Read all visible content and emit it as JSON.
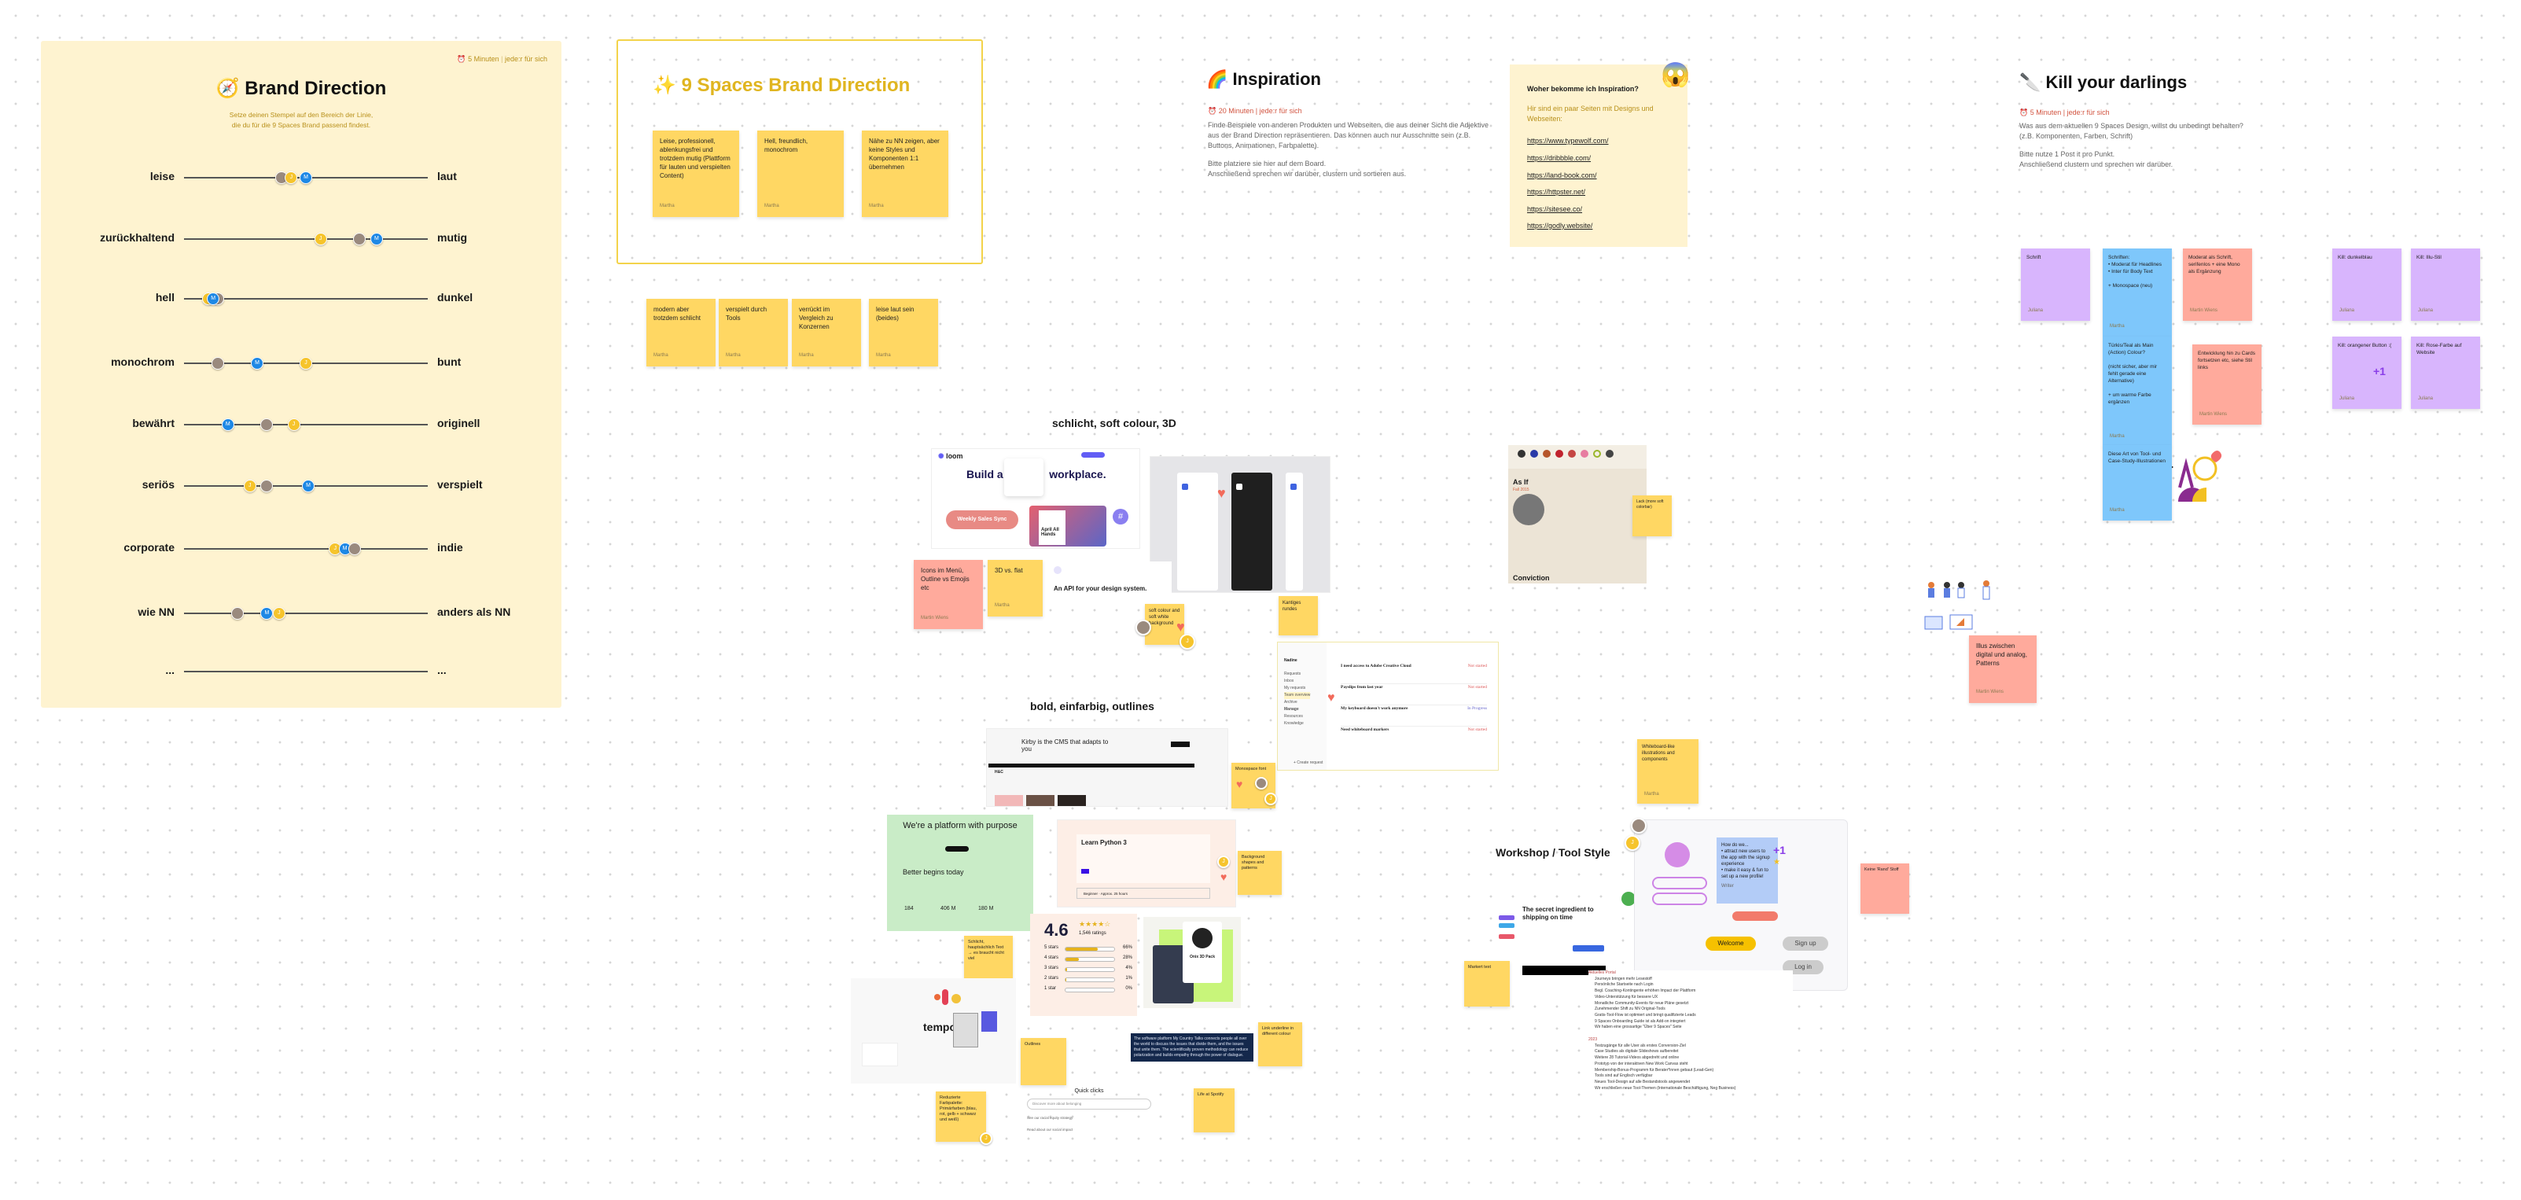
{
  "brand_direction": {
    "timer_icon": "alarm-clock-icon",
    "timer": "5 Minuten",
    "mode": "jede:r für sich",
    "title_icon": "compass-icon",
    "title": "Brand Direction",
    "subtitle_1": "Setze deinen Stempel auf den Bereich der Linie,",
    "subtitle_2": "die du für die 9 Spaces Brand passend findest.",
    "scales": [
      {
        "left": "leise",
        "right": "laut",
        "votes": {
          "photo": 0.4,
          "J": 0.44,
          "M": 0.5
        }
      },
      {
        "left": "zurückhaltend",
        "right": "mutig",
        "votes": {
          "J": 0.56,
          "photo": 0.72,
          "M": 0.79
        }
      },
      {
        "left": "hell",
        "right": "dunkel",
        "votes": {
          "J": 0.1,
          "photo": 0.14,
          "M": 0.12
        }
      },
      {
        "left": "monochrom",
        "right": "bunt",
        "votes": {
          "photo": 0.14,
          "M": 0.3,
          "J": 0.5
        }
      },
      {
        "left": "bewährt",
        "right": "originell",
        "votes": {
          "M": 0.18,
          "photo": 0.34,
          "J": 0.45
        }
      },
      {
        "left": "seriös",
        "right": "verspielt",
        "votes": {
          "J": 0.27,
          "photo": 0.34,
          "M": 0.51
        }
      },
      {
        "left": "corporate",
        "right": "indie",
        "votes": {
          "J": 0.62,
          "M": 0.66,
          "photo": 0.7
        }
      },
      {
        "left": "wie NN",
        "right": "anders als NN",
        "votes": {
          "photo": 0.22,
          "M": 0.34,
          "J": 0.39
        }
      },
      {
        "left": "...",
        "right": "...",
        "votes": {}
      }
    ]
  },
  "nine_spaces": {
    "title_icon": "sparkles-icon",
    "title": "9 Spaces Brand Direction",
    "notes": [
      {
        "text": "Leise, professionell, ablenkungsfrei und trotzdem mutig (Plattform für lauten und verspielten Content)",
        "author": "Martha"
      },
      {
        "text": "Hell, freundlich, monochrom",
        "author": "Martha"
      },
      {
        "text": "Nähe zu NN zeigen, aber keine Styles und Komponenten 1:1 übernehmen",
        "author": "Martha"
      }
    ],
    "extra_notes": [
      {
        "text": "modern aber trotzdem schlicht",
        "author": "Martha"
      },
      {
        "text": "verspielt durch Tools",
        "author": "Martha"
      },
      {
        "text": "verrückt im Vergleich zu Konzernen",
        "author": "Martha"
      },
      {
        "text": "leise laut sein (beides)",
        "author": "Martha"
      }
    ]
  },
  "inspiration": {
    "title_icon": "rainbow-icon",
    "title": "Inspiration",
    "timer": "20 Minuten",
    "mode": "jede:r für sich",
    "body_1": "Finde Beispiele von anderen Produkten und Webseiten, die aus deiner Sicht die Adjektive aus der Brand Direction repräsentieren. Das können auch nur Ausschnitte sein (z.B. Buttons, Animationen, Farbpalette).",
    "body_2": "Bitte platziere sie hier auf dem Board.",
    "body_3": "Anschließend sprechen wir darüber, clustern und sortieren aus.",
    "box_emoji": "screaming-face-icon",
    "box_question": "Woher bekomme ich Inspiration?",
    "box_text": "Hir sind ein paar Seiten mit Designs und Webseiten:",
    "links": [
      "https://www.typewolf.com/",
      "https://dribbble.com/",
      "https://land-book.com/",
      "https://httpster.net/",
      "https://sitesee.co/",
      "https://godly.website/"
    ]
  },
  "kill": {
    "title_icon": "knife-icon",
    "title": "Kill your darlings",
    "timer": "5 Minuten",
    "mode": "jede:r für sich",
    "body_1": "Was aus dem aktuellen 9 Spaces Design, willst du unbedingt behalten?",
    "body_2": "(z.B. Komponenten, Farben, Schrift)",
    "body_3": "Bitte nutze 1 Post it pro Punkt.",
    "body_4": "Anschließend clustern und sprechen wir darüber.",
    "notes": [
      {
        "text": "Schrift",
        "author": "Juliana",
        "color": "purple"
      },
      {
        "text": "Schriften:\n• Moderat für Headlines\n• Inter für Body Text\n\n+ Monospace (neu)",
        "author": "Martha",
        "color": "blue"
      },
      {
        "text": "Moderat als Schrift, serifenlos + eine Mono als Ergänzung",
        "author": "Martin Wiens",
        "color": "pink"
      },
      {
        "text": "Kill: dunkelblau",
        "author": "Juliana",
        "color": "purple"
      },
      {
        "text": "Kill: Illu-Stil",
        "author": "Juliana",
        "color": "purple"
      },
      {
        "text": "Türkis/Teal als Main (Action) Colour?\n\n(nicht sicher, aber mir fehlt gerade eine Alternative)\n\n+ um warme Farbe ergänzen",
        "author": "Martha",
        "color": "blue"
      },
      {
        "text": "Entwicklung hin zu Cards fortsetzen etc, siehe Stil links",
        "author": "Martin Wiens",
        "color": "pink"
      },
      {
        "text": "Kill: orangener Button :(",
        "author": "Juliana",
        "color": "purple",
        "badge": "+1"
      },
      {
        "text": "Kill: Rose-Farbe auf Website",
        "author": "Juliana",
        "color": "purple"
      },
      {
        "text": "Diese Art von Tool- und Case-Study-Illustrationen",
        "author": "Martha",
        "color": "blue"
      }
    ]
  },
  "clusters": {
    "soft": "schlicht, soft colour, 3D",
    "bold": "bold, einfarbig, outlines",
    "workshop": "Workshop / Tool Style"
  },
  "loom_shot": {
    "logo": "loom",
    "headline_a": "Build a t",
    "headline_b": "workplace.",
    "pill": "Weekly Sales Sync",
    "card": "April All Hands",
    "api_title": "An API for your design system."
  },
  "kirby_shot": {
    "headline": "Kirby is the CMS that adapts to you",
    "section": "H&C"
  },
  "platform_shot": {
    "headline": "We're a platform with purpose",
    "sub": "Better begins today",
    "stats": [
      "184",
      "406 M",
      "180 M"
    ]
  },
  "python_shot": {
    "title": "Learn Python 3",
    "level": "Beginner",
    "time": "Approx. 25 hours"
  },
  "rating_shot": {
    "score": "4.6",
    "count": "1,546 ratings",
    "rows": [
      {
        "label": "5 stars",
        "pct": 66
      },
      {
        "label": "4 stars",
        "pct": 28
      },
      {
        "label": "3 stars",
        "pct": 4
      },
      {
        "label": "2 stars",
        "pct": 1
      },
      {
        "label": "1 star",
        "pct": 0
      }
    ]
  },
  "product_shot": {
    "title": "Onix 3D Pack"
  },
  "country_talks": {
    "text": "The software platform My Country Talks connects people all over the world to discuss the issues that divide them, and the issues that unite them. The scientifically proven methodology can reduce polarization and builds empathy through the power of dialogue."
  },
  "quick_clicks": {
    "title": "Quick clicks",
    "search": "Discover more about belonging",
    "items": [
      "See our racial equity strategy",
      "Read about our social impact"
    ]
  },
  "tempo_shot": {
    "word": "tempo"
  },
  "helpdesk_shot": {
    "user": "Nadine",
    "nav": [
      "Requests",
      "Inbox",
      "My requests",
      "Team overview",
      "Archive",
      "Manage",
      "Resources",
      "Knowledge"
    ],
    "items": [
      {
        "title": "I need access to Adobe Creative Cloud",
        "status": "Not started"
      },
      {
        "title": "Payslips from last year",
        "status": "Not started"
      },
      {
        "title": "My keyboard doesn't work anymore",
        "status": "In Progress"
      },
      {
        "title": "Need whiteboard markers",
        "status": "Not started"
      }
    ],
    "footer": "+ Create request"
  },
  "as_if_shot": {
    "title": "As If",
    "season": "Fall 2015",
    "next": "Conviction"
  },
  "workshop_shot": {
    "headline": "The secret ingredient to shipping on time",
    "question": "How do we...",
    "bullets": [
      "attract new users to the app with the signup experience",
      "make it easy & fun to set up a new profile!"
    ],
    "writer": "Writer",
    "welcome": "Welcome",
    "signup": "Sign up",
    "login": "Log in"
  },
  "roadmap": {
    "group_1": "Aktuelles Portal",
    "rows_1": [
      "Journeys bringen mehr Lesestoff",
      "Persönliche Startseite nach Login",
      "Begl. Coaching-Kontingente erhöhen Impact der Plattform",
      "Video-Unterstützung für bessere UX",
      "Monatliche Community-Events für neue Pläne gesetzt",
      "Zunehmender Shift zu NN Original-Tools",
      "Gratis-Tool-Flow ist optimiert und bringt qualifizierte Leads",
      "9 Spaces Onboarding Guide ist als Add-on integriert",
      "Wir haben eine grossartige \"Über 9 Spaces\" Seite"
    ],
    "group_2": "2023",
    "rows_2": [
      "Testzugänge für alle User als erstes Conversion-Ziel",
      "Case Studies als digitale Slideshows aufbereitet",
      "Weitere 28 Tutorial-Videos abgedreht und online",
      "Prototyp von der interaktiven New Work Canvas steht",
      "Membership-Bonus-Programm für Berater*innen gebaut (Lead-Gen)",
      "Tools sind auf Englisch verfügbar",
      "Neues Tool-Design auf alle Bestandstools angewendet",
      "Wir erschließen neue Tool-Themen (Internationale Beschäftigung, Neg Business)"
    ]
  },
  "scattered_notes": [
    {
      "id": "icons",
      "text": "Icons im Menü, Outline vs Emojis etc",
      "author": "Martin Wiens",
      "color": "pink"
    },
    {
      "id": "3d",
      "text": "3D vs. flat",
      "author": "Martha",
      "color": "yellow"
    },
    {
      "id": "softwhite",
      "text": "soft colour and soft white background",
      "author": "Martha",
      "color": "yellow"
    },
    {
      "id": "kantig",
      "text": "Kantiges rundes",
      "author": "Juliana",
      "color": "yellow"
    },
    {
      "id": "mono",
      "text": "Monospace font",
      "author": "Martha",
      "color": "yellow"
    },
    {
      "id": "bgshapes",
      "text": "Background shapes and patterns",
      "author": "Martha",
      "color": "yellow"
    },
    {
      "id": "schlicht",
      "text": "Schlicht, hauptsächlich Text\n→ es braucht nicht viel",
      "author": "Martha",
      "color": "yellow"
    },
    {
      "id": "outlines",
      "text": "Outlines",
      "author": "Martha",
      "color": "yellow"
    },
    {
      "id": "links",
      "text": "Link underline in different colour",
      "author": "Martha",
      "color": "yellow"
    },
    {
      "id": "farb",
      "text": "Reduzierte Farbpalette: Primärfarben (blau, rot, gelb + schwarz und weiß)",
      "author": "Martha",
      "color": "yellow"
    },
    {
      "id": "spotify",
      "text": "Life at Spotify",
      "author": "Martha",
      "color": "yellow"
    },
    {
      "id": "lack",
      "text": "Lack (more soft colorbar)",
      "author": "Martha",
      "color": "yellow"
    },
    {
      "id": "whiteboard",
      "text": "Whiteboard-like illustrations and components",
      "author": "Martha",
      "color": "yellow"
    },
    {
      "id": "marker",
      "text": "Markert text",
      "author": "Martha",
      "color": "yellow"
    },
    {
      "id": "kanten",
      "text": "Keine 'Rand' Stoff",
      "author": "Martha",
      "color": "pink"
    },
    {
      "id": "illus",
      "text": "Illus zwischen digital und analog, Patterns",
      "author": "Martin Wiens",
      "color": "pink"
    }
  ]
}
